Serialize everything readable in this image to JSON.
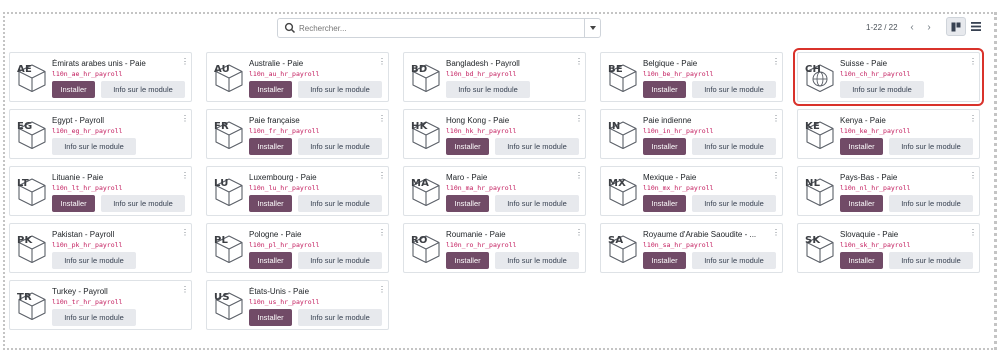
{
  "search": {
    "placeholder": "Rechercher..."
  },
  "pager": {
    "value": "1-22 / 22"
  },
  "buttons": {
    "install_label": "Installer",
    "info_label": "Info sur le module"
  },
  "colors": {
    "brand": "#714b67",
    "tech_name": "#c2185b",
    "selection": "#d9322b"
  },
  "modules": [
    {
      "code": "AE",
      "name": "Émirats arabes unis - Paie",
      "tech": "l10n_ae_hr_payroll",
      "installable": true
    },
    {
      "code": "AU",
      "name": "Australie - Paie",
      "tech": "l10n_au_hr_payroll",
      "installable": true
    },
    {
      "code": "BD",
      "name": "Bangladesh - Payroll",
      "tech": "l10n_bd_hr_payroll",
      "installable": false
    },
    {
      "code": "BE",
      "name": "Belgique - Paie",
      "tech": "l10n_be_hr_payroll",
      "installable": true
    },
    {
      "code": "CH",
      "name": "Suisse - Paie",
      "tech": "l10n_ch_hr_payroll",
      "installable": false,
      "selected": true,
      "globe": true
    },
    {
      "code": "EG",
      "name": "Egypt - Payroll",
      "tech": "l10n_eg_hr_payroll",
      "installable": false
    },
    {
      "code": "FR",
      "name": "Paie française",
      "tech": "l10n_fr_hr_payroll",
      "installable": true
    },
    {
      "code": "HK",
      "name": "Hong Kong - Paie",
      "tech": "l10n_hk_hr_payroll",
      "installable": true
    },
    {
      "code": "IN",
      "name": "Paie indienne",
      "tech": "l10n_in_hr_payroll",
      "installable": true
    },
    {
      "code": "KE",
      "name": "Kenya - Paie",
      "tech": "l10n_ke_hr_payroll",
      "installable": true
    },
    {
      "code": "LT",
      "name": "Lituanie - Paie",
      "tech": "l10n_lt_hr_payroll",
      "installable": true
    },
    {
      "code": "LU",
      "name": "Luxembourg - Paie",
      "tech": "l10n_lu_hr_payroll",
      "installable": true
    },
    {
      "code": "MA",
      "name": "Maro - Paie",
      "tech": "l10n_ma_hr_payroll",
      "installable": true
    },
    {
      "code": "MX",
      "name": "Mexique - Paie",
      "tech": "l10n_mx_hr_payroll",
      "installable": true
    },
    {
      "code": "NL",
      "name": "Pays-Bas - Paie",
      "tech": "l10n_nl_hr_payroll",
      "installable": true
    },
    {
      "code": "PK",
      "name": "Pakistan - Payroll",
      "tech": "l10n_pk_hr_payroll",
      "installable": false
    },
    {
      "code": "PL",
      "name": "Pologne - Paie",
      "tech": "l10n_pl_hr_payroll",
      "installable": true
    },
    {
      "code": "RO",
      "name": "Roumanie - Paie",
      "tech": "l10n_ro_hr_payroll",
      "installable": true
    },
    {
      "code": "SA",
      "name": "Royaume d'Arabie Saoudite - ...",
      "tech": "l10n_sa_hr_payroll",
      "installable": true
    },
    {
      "code": "SK",
      "name": "Slovaquie - Paie",
      "tech": "l10n_sk_hr_payroll",
      "installable": true
    },
    {
      "code": "TR",
      "name": "Turkey - Payroll",
      "tech": "l10n_tr_hr_payroll",
      "installable": false
    },
    {
      "code": "US",
      "name": "États-Unis - Paie",
      "tech": "l10n_us_hr_payroll",
      "installable": true
    }
  ]
}
